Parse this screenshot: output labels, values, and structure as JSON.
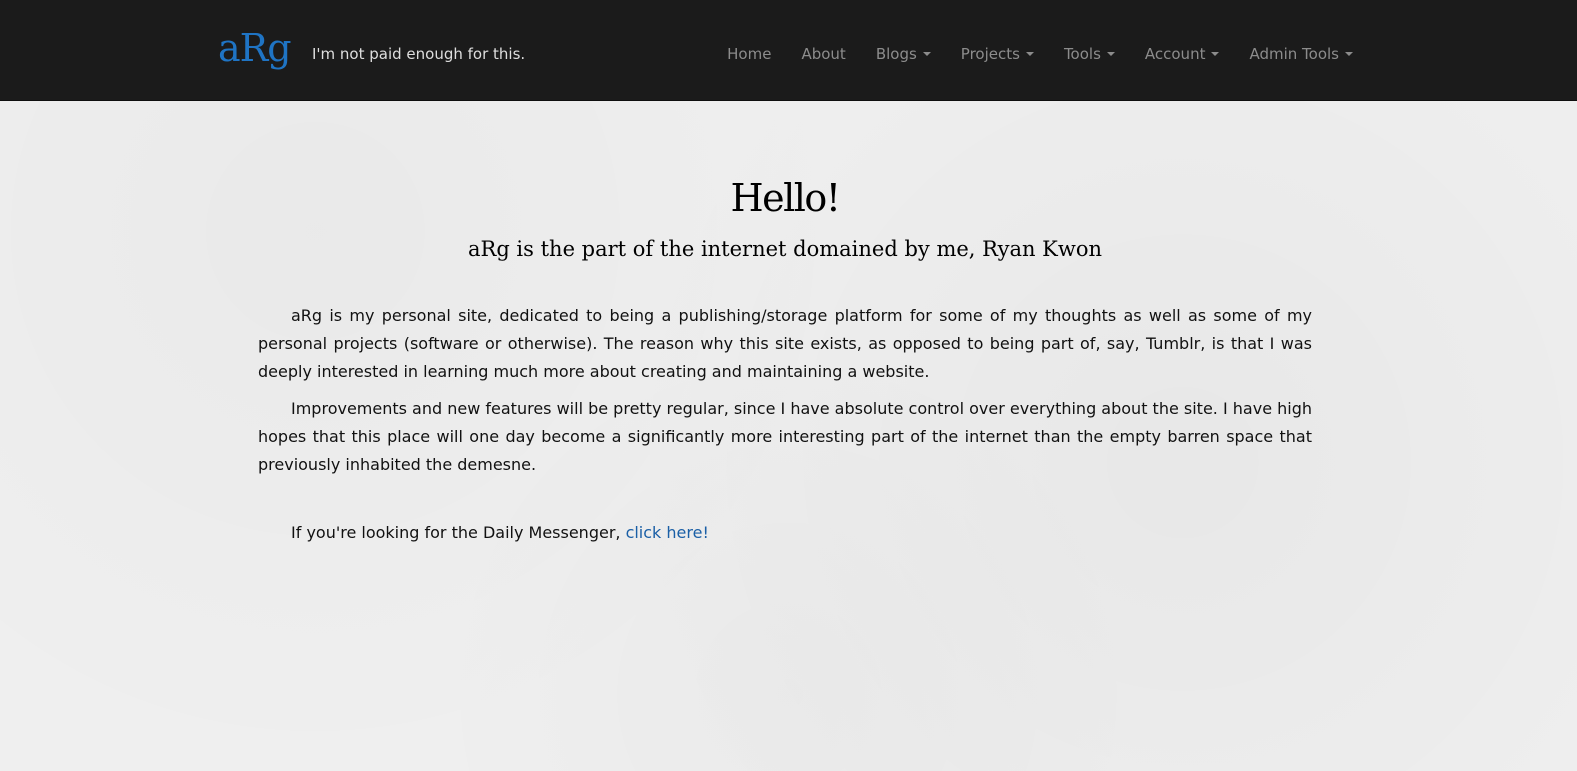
{
  "header": {
    "brand": "aRg",
    "tagline": "I'm not paid enough for this.",
    "nav": [
      {
        "label": "Home"
      },
      {
        "label": "About"
      },
      {
        "label": "Blogs"
      },
      {
        "label": "Projects"
      },
      {
        "label": "Tools"
      },
      {
        "label": "Account"
      },
      {
        "label": "Admin Tools"
      }
    ]
  },
  "main": {
    "title": "Hello!",
    "subtitle": "aRg is the part of the internet domained by me, Ryan Kwon",
    "paragraph1": "aRg is my personal site, dedicated to being a publishing/storage platform for some of my thoughts as well as some of my personal projects (software or otherwise). The reason why this site exists, as opposed to being part of, say, Tumblr, is that I was deeply interested in learning much more about creating and maintaining a website.",
    "paragraph2": "Improvements and new features will be pretty regular, since I have absolute control over everything about the site. I have high hopes that this place will one day become a significantly more interesting part of the internet than the empty barren space that previously inhabited the demesne.",
    "messenger_prefix": "If you're looking for the Daily Messenger, ",
    "messenger_link": "click here!"
  },
  "colors": {
    "navbar": "#1b1b1b",
    "brand": "#1f74c4",
    "nav_text": "#8c8c8c",
    "link": "#1a5fa6",
    "page_bg": "#efefef"
  }
}
